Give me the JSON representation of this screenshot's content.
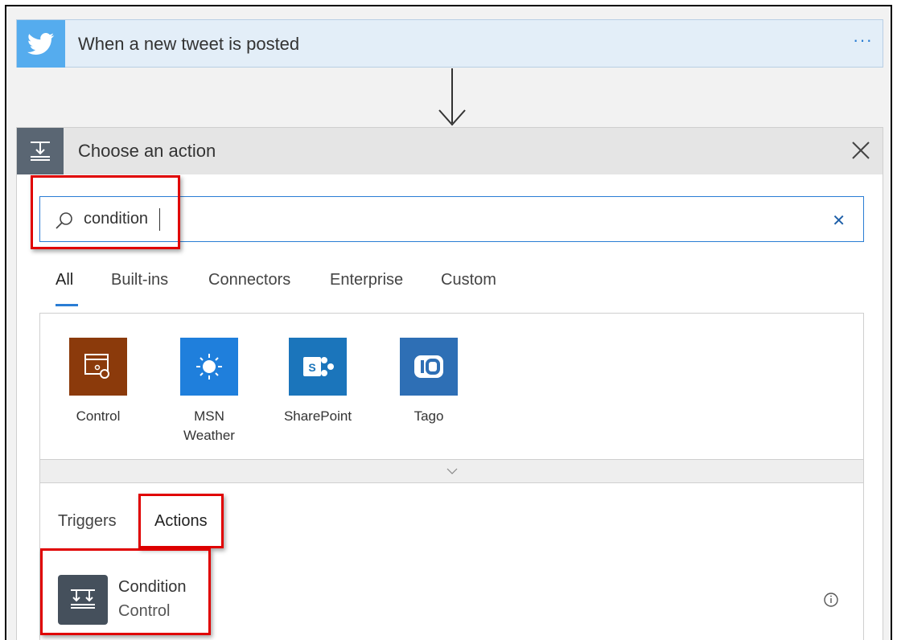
{
  "trigger": {
    "title": "When a new tweet is posted",
    "more": "···",
    "icon": "twitter-bird-icon",
    "color": "#55acee"
  },
  "panel": {
    "title": "Choose an action",
    "icon": "action-icon"
  },
  "search": {
    "value": "condition"
  },
  "tabs": [
    "All",
    "Built-ins",
    "Connectors",
    "Enterprise",
    "Custom"
  ],
  "connectors": [
    {
      "label": "Control",
      "color": "#8b3a0b",
      "icon": "control-icon"
    },
    {
      "label": "MSN\nWeather",
      "color": "#1f7fdc",
      "icon": "sun-icon"
    },
    {
      "label": "SharePoint",
      "color": "#1b75bb",
      "icon": "sharepoint-icon"
    },
    {
      "label": "Tago",
      "color": "#2e6fb5",
      "icon": "tago-icon"
    }
  ],
  "subtabs": {
    "triggers": "Triggers",
    "actions": "Actions"
  },
  "result": {
    "title": "Condition",
    "subtitle": "Control",
    "icon": "condition-icon"
  },
  "colors": {
    "accent": "#2a7dd4",
    "highlight": "#e00000"
  }
}
